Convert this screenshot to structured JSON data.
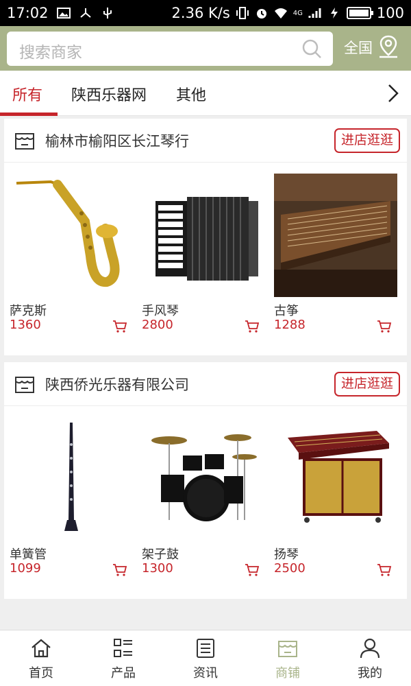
{
  "status_bar": {
    "time": "17:02",
    "net_speed": "2.36 K/s",
    "network": "4G",
    "battery": "100"
  },
  "header": {
    "search_placeholder": "搜索商家",
    "region": "全国"
  },
  "tabs": [
    {
      "label": "所有",
      "active": true
    },
    {
      "label": "陕西乐器网",
      "active": false
    },
    {
      "label": "其他",
      "active": false
    }
  ],
  "stores": [
    {
      "name": "榆林市榆阳区长江琴行",
      "button": "进店逛逛",
      "products": [
        {
          "name": "萨克斯",
          "price": "1360"
        },
        {
          "name": "手风琴",
          "price": "2800"
        },
        {
          "name": "古筝",
          "price": "1288"
        }
      ]
    },
    {
      "name": "陕西侨光乐器有限公司",
      "button": "进店逛逛",
      "products": [
        {
          "name": "单簧管",
          "price": "1099"
        },
        {
          "name": "架子鼓",
          "price": "1300"
        },
        {
          "name": "扬琴",
          "price": "2500"
        }
      ]
    }
  ],
  "bottom_nav": [
    {
      "label": "首页",
      "icon": "home-icon",
      "active": false
    },
    {
      "label": "产品",
      "icon": "grid-list-icon",
      "active": false
    },
    {
      "label": "资讯",
      "icon": "news-icon",
      "active": false
    },
    {
      "label": "商铺",
      "icon": "store-icon",
      "active": true
    },
    {
      "label": "我的",
      "icon": "user-icon",
      "active": false
    }
  ],
  "colors": {
    "accent": "#c6252b",
    "header_bg": "#a9b48a",
    "page_bg": "#efefef"
  }
}
